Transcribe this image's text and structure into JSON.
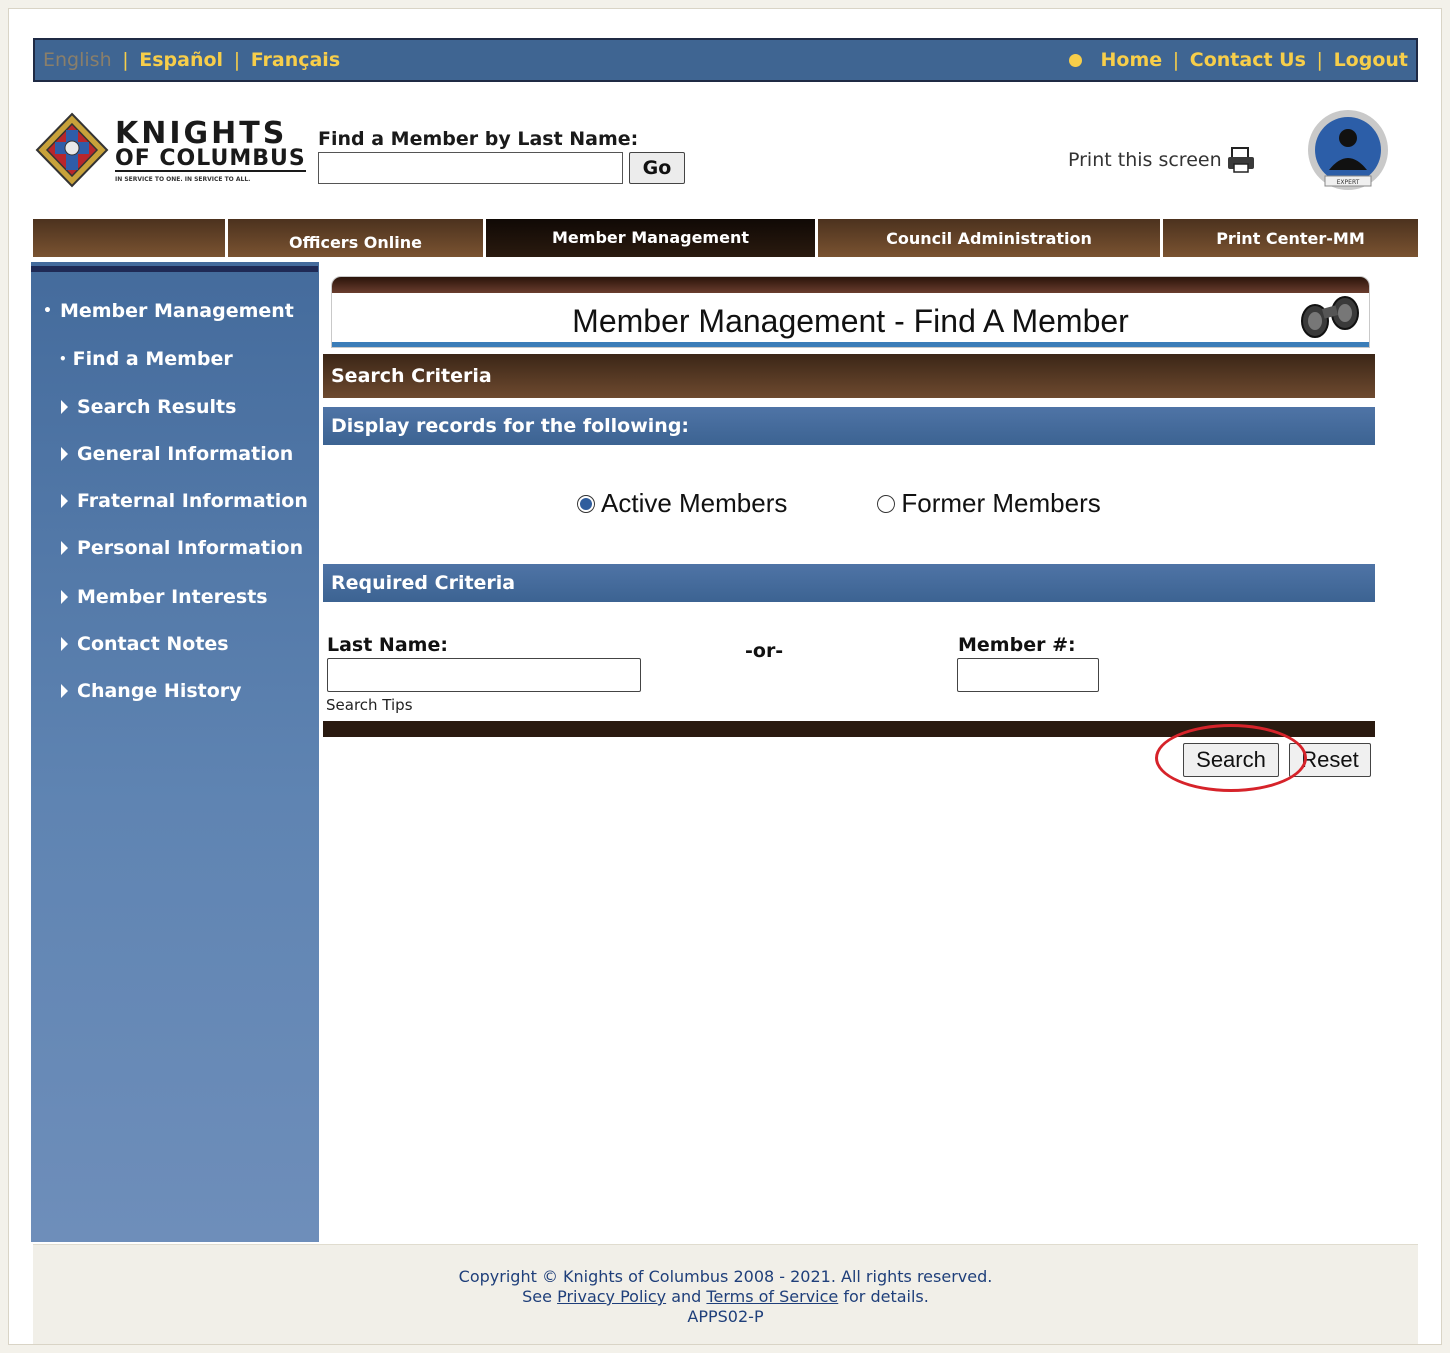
{
  "topbar": {
    "lang_english": "English",
    "lang_spanish": "Español",
    "lang_french": "Français",
    "link_home": "Home",
    "link_contact": "Contact Us",
    "link_logout": "Logout",
    "separator": "|"
  },
  "header": {
    "logo_knights": "KNIGHTS",
    "logo_of_columbus": "OF COLUMBUS",
    "logo_tagline": "IN SERVICE TO ONE. IN SERVICE TO ALL.",
    "find_label": "Find a Member by Last Name:",
    "find_value": "",
    "go_label": "Go",
    "print_label": "Print this screen",
    "expert_badge": "EXPERT"
  },
  "nav": {
    "tabs": [
      "Officers Online",
      "Member Management",
      "Council Administration",
      "Print Center-MM"
    ]
  },
  "sidebar": {
    "section": "Member Management",
    "items": [
      "Find a Member",
      "Search Results",
      "General Information",
      "Fraternal Information",
      "Personal Information",
      "Member Interests",
      "Contact Notes",
      "Change History"
    ]
  },
  "main": {
    "title": "Member Management - Find A Member",
    "search_criteria": "Search Criteria",
    "display_records": "Display records for the following:",
    "radio_active": "Active Members",
    "radio_former": "Former Members",
    "required_criteria": "Required Criteria",
    "last_name_label": "Last Name:",
    "or_label": "-or-",
    "member_no_label": "Member #:",
    "search_tips": "Search Tips",
    "search_button": "Search",
    "reset_button": "Reset"
  },
  "footer": {
    "copyright": "Copyright © Knights of Columbus 2008 - 2021. All rights reserved.",
    "see": "See",
    "privacy": "Privacy Policy",
    "and": "and",
    "terms": "Terms of Service",
    "details": "for details.",
    "code": "APPS02-P"
  },
  "colors": {
    "topbar_blue": "#3f6592",
    "link_gold": "#f7ce4a",
    "bar_brown": "#4a2f1d",
    "highlight_red": "#d6232a"
  }
}
